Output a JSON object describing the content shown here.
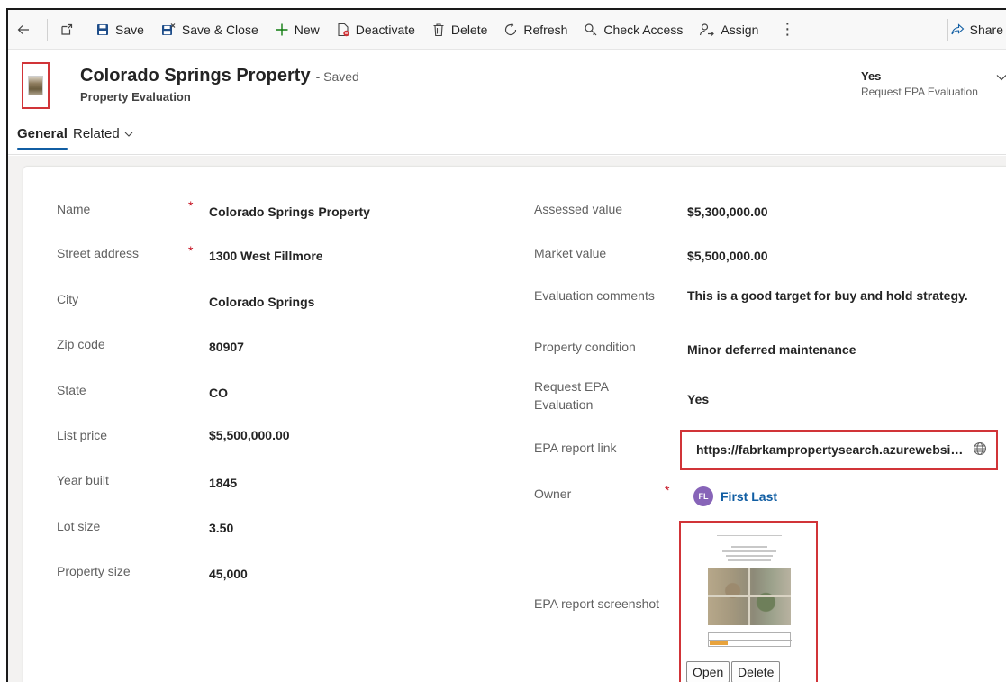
{
  "toolbar": {
    "back_icon": "arrow-left-icon",
    "popout_icon": "open-in-new-window-icon",
    "save": "Save",
    "save_close": "Save & Close",
    "new": "New",
    "deactivate": "Deactivate",
    "delete": "Delete",
    "refresh": "Refresh",
    "check_access": "Check Access",
    "assign": "Assign",
    "share": "Share"
  },
  "header": {
    "title": "Colorado Springs Property",
    "status": "- Saved",
    "entity": "Property Evaluation",
    "field_value": "Yes",
    "field_label": "Request EPA Evaluation"
  },
  "tabs": {
    "general": "General",
    "related": "Related"
  },
  "form": {
    "left": [
      {
        "label": "Name",
        "value": "Colorado Springs Property",
        "required": "*"
      },
      {
        "label": "Street address",
        "value": "1300 West Fillmore",
        "required": "*"
      },
      {
        "label": "City",
        "value": "Colorado Springs"
      },
      {
        "label": "Zip code",
        "value": "80907"
      },
      {
        "label": "State",
        "value": "CO"
      },
      {
        "label": "List price",
        "value": "$5,500,000.00"
      },
      {
        "label": "Year built",
        "value": "1845"
      },
      {
        "label": "Lot size",
        "value": "3.50"
      },
      {
        "label": "Property size",
        "value": "45,000"
      }
    ],
    "right": {
      "assessed_label": "Assessed value",
      "assessed_value": "$5,300,000.00",
      "market_label": "Market value",
      "market_value": "$5,500,000.00",
      "comments_label": "Evaluation comments",
      "comments_value": "This is a good target for buy and hold strategy.",
      "condition_label": "Property condition",
      "condition_value": "Minor deferred maintenance",
      "epa_request_label": "Request EPA Evaluation",
      "epa_request_value": "Yes",
      "epa_link_label": "EPA report link",
      "epa_link_value": "https://fabrkampropertysearch.azurewebsites.net",
      "owner_label": "Owner",
      "owner_required": "*",
      "owner_initials": "FL",
      "owner_name": "First Last",
      "screenshot_label": "EPA report screenshot",
      "open_button": "Open",
      "delete_button": "Delete"
    }
  },
  "colors": {
    "accent": "#115ea3",
    "highlight_border": "#d13438",
    "avatar_bg": "#8764b8",
    "required": "#c50f1f"
  }
}
